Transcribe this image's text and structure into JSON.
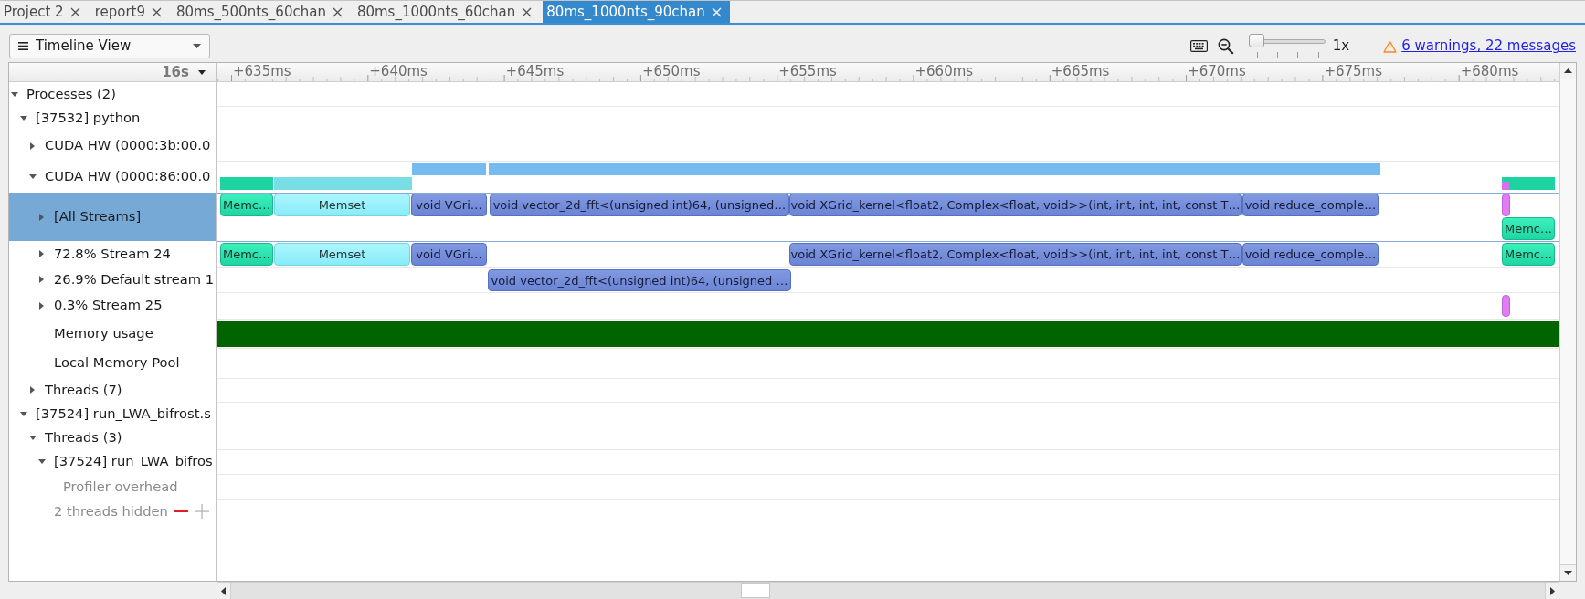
{
  "tabs": [
    {
      "label": "Project 2",
      "selected": false
    },
    {
      "label": "report9",
      "selected": false
    },
    {
      "label": "80ms_500nts_60chan",
      "selected": false
    },
    {
      "label": "80ms_1000nts_60chan",
      "selected": false
    },
    {
      "label": "80ms_1000nts_90chan",
      "selected": true
    }
  ],
  "toolbar": {
    "view_menu": "Timeline View",
    "zoom_slider": {
      "level": 0
    },
    "zoom_reading": "1x",
    "issues_link": "6 warnings, 22 messages"
  },
  "timeline": {
    "range_menu": "16s",
    "ruler_labels": [
      "+635ms",
      "+640ms",
      "+645ms",
      "+650ms",
      "+655ms",
      "+660ms",
      "+665ms",
      "+670ms",
      "+675ms",
      "+680ms"
    ],
    "rows": [
      {
        "label": "Processes (2)",
        "kind": "row",
        "expanded": true,
        "selected": false,
        "dimmed": false,
        "children": [
          {
            "label": "[37532] python",
            "kind": "row",
            "expanded": true,
            "selected": false,
            "dimmed": false,
            "children": [
              {
                "label": "CUDA HW (0000:3b:00.0",
                "kind": "row",
                "expanded": false,
                "selected": false,
                "dimmed": false
              },
              {
                "label": "CUDA HW (0000:86:00.0",
                "kind": "row",
                "expanded": true,
                "selected": false,
                "dimmed": false,
                "track": [
                  {
                    "kind": "memcpy_summary"
                  },
                  {
                    "kind": "memset_summary"
                  },
                  {
                    "kind": "kernel_summary"
                  },
                  {
                    "kind": "kernel_summary"
                  },
                  {
                    "kind": "memcpy_summary"
                  },
                  {
                    "kind": "marker_summary"
                  }
                ],
                "children": [
                  {
                    "label": "[All Streams]",
                    "kind": "row",
                    "expanded": false,
                    "selected": true,
                    "dimmed": false,
                    "track": [
                      {
                        "kind": "memcpy",
                        "label": "Memc…"
                      },
                      {
                        "kind": "memset",
                        "label": "Memset"
                      },
                      {
                        "kind": "kernel",
                        "label": "void VGri…"
                      },
                      {
                        "kind": "kernel",
                        "label": "void vector_2d_fft<(unsigned int)64, (unsigned…"
                      },
                      {
                        "kind": "kernel",
                        "label": "void XGrid_kernel<float2, Complex<float, void>>(int, int, int, int, const T…"
                      },
                      {
                        "kind": "kernel",
                        "label": "void reduce_comple…"
                      },
                      {
                        "kind": "marker"
                      },
                      {
                        "kind": "memcpy",
                        "label": "Memc…"
                      }
                    ]
                  },
                  {
                    "label": "72.8% Stream 24",
                    "kind": "row",
                    "expanded": false,
                    "selected": false,
                    "dimmed": false,
                    "track": [
                      {
                        "kind": "memcpy",
                        "label": "Memc…"
                      },
                      {
                        "kind": "memset",
                        "label": "Memset"
                      },
                      {
                        "kind": "kernel",
                        "label": "void VGri…"
                      },
                      {
                        "kind": "kernel",
                        "label": "void XGrid_kernel<float2, Complex<float, void>>(int, int, int, int, const T…"
                      },
                      {
                        "kind": "kernel",
                        "label": "void reduce_comple…"
                      },
                      {
                        "kind": "memcpy",
                        "label": "Memc…"
                      }
                    ]
                  },
                  {
                    "label": "26.9% Default stream 1",
                    "kind": "row",
                    "expanded": false,
                    "selected": false,
                    "dimmed": false,
                    "track": [
                      {
                        "kind": "kernel",
                        "label": "void vector_2d_fft<(unsigned int)64, (unsigned …"
                      }
                    ]
                  },
                  {
                    "label": "0.3% Stream 25",
                    "kind": "row",
                    "expanded": false,
                    "selected": false,
                    "dimmed": false,
                    "track": [
                      {
                        "kind": "marker"
                      }
                    ]
                  },
                  {
                    "label": "Memory usage",
                    "kind": "row",
                    "selected": false,
                    "dimmed": false,
                    "track": [
                      {
                        "kind": "memory_usage"
                      }
                    ]
                  },
                  {
                    "label": "Local Memory Pool",
                    "kind": "row",
                    "selected": false,
                    "dimmed": false
                  }
                ]
              },
              {
                "label": "Threads (7)",
                "kind": "row",
                "expanded": false,
                "selected": false,
                "dimmed": false
              }
            ]
          },
          {
            "label": "[37524] run_LWA_bifrost.s",
            "kind": "row",
            "expanded": true,
            "selected": false,
            "dimmed": false,
            "children": [
              {
                "label": "Threads (3)",
                "kind": "row",
                "expanded": true,
                "selected": false,
                "dimmed": false,
                "children": [
                  {
                    "label": "[37524] run_LWA_bifros",
                    "kind": "row",
                    "expanded": true,
                    "selected": false,
                    "dimmed": false,
                    "children": [
                      {
                        "label": "Profiler overhead",
                        "kind": "row",
                        "selected": false,
                        "dimmed": true
                      }
                    ]
                  },
                  {
                    "label": "2 threads hidden",
                    "kind": "hidden_summary",
                    "selected": false,
                    "dimmed": true
                  }
                ]
              }
            ]
          }
        ]
      }
    ]
  }
}
